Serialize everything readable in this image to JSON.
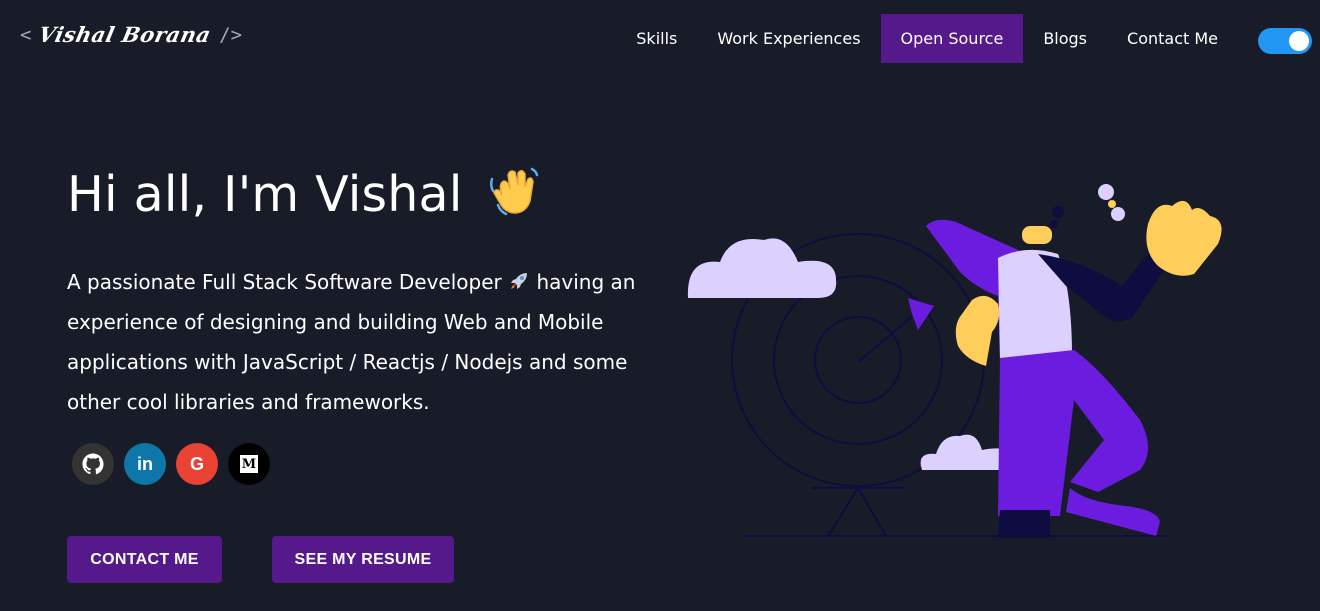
{
  "logo": {
    "open": "<",
    "signature": "Vishal Borana",
    "close": "/>"
  },
  "nav": [
    {
      "label": "Skills"
    },
    {
      "label": "Work Experiences"
    },
    {
      "label": "Open Source",
      "active": true
    },
    {
      "label": "Blogs"
    },
    {
      "label": "Contact Me"
    }
  ],
  "hero": {
    "greeting": "Hi all, I'm Vishal",
    "subtitle_part1": "A passionate Full Stack Software Developer",
    "subtitle_part2": " having an experience of designing and building Web and Mobile applications with JavaScript / Reactjs / Nodejs and some other cool libraries and frameworks."
  },
  "socials": [
    {
      "name": "github",
      "glyph": "⌂"
    },
    {
      "name": "linkedin",
      "glyph": "in"
    },
    {
      "name": "google",
      "glyph": "G"
    },
    {
      "name": "medium",
      "glyph": "M"
    }
  ],
  "buttons": {
    "contact": "CONTACT ME",
    "resume": "SEE MY RESUME"
  },
  "colors": {
    "background": "#171c28",
    "accent": "#55198b",
    "toggle": "#2196f3"
  }
}
